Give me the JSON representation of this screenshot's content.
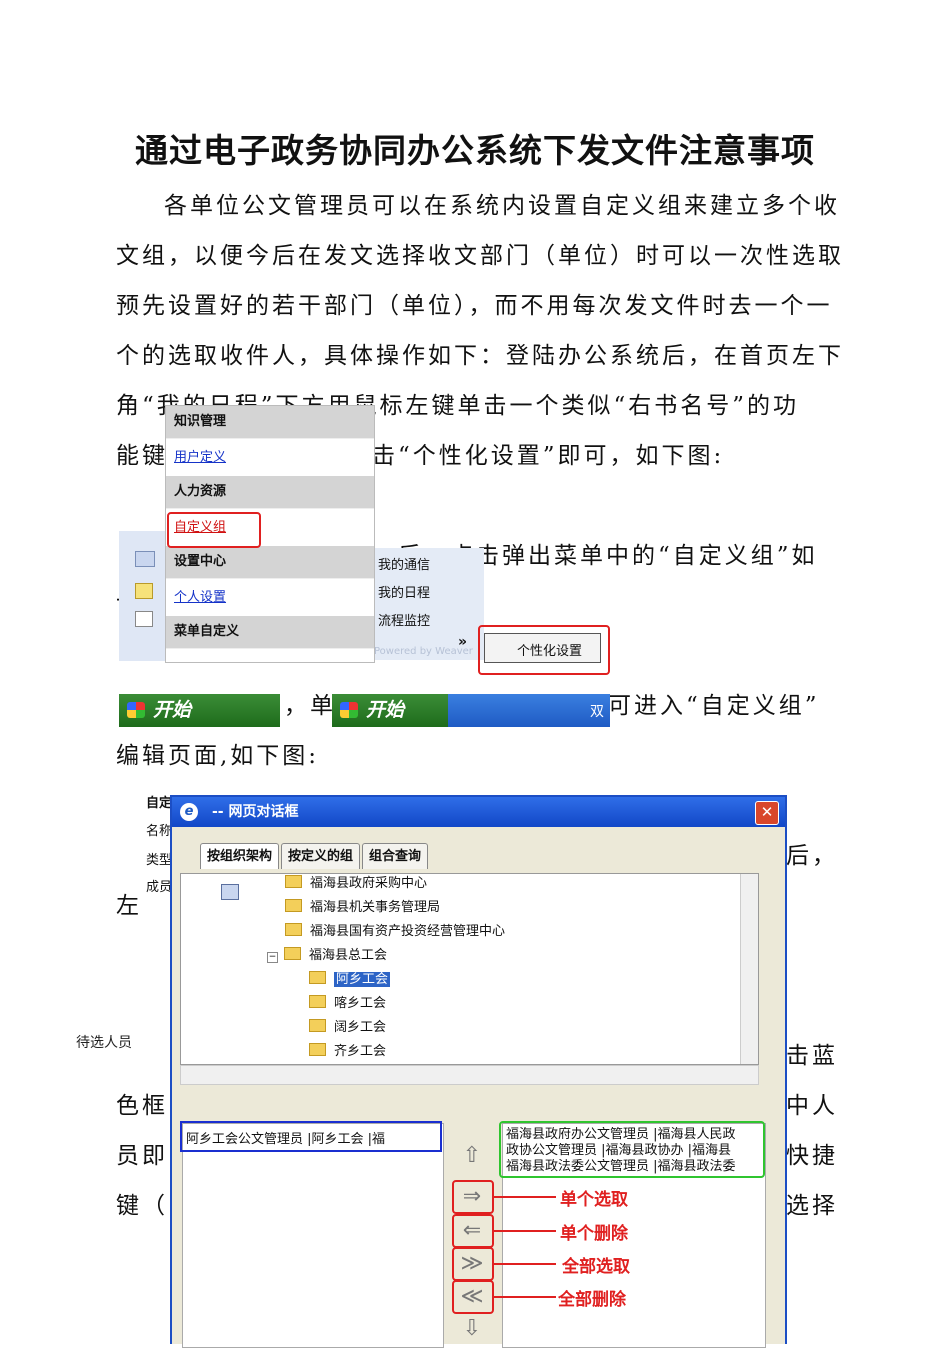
{
  "title": "通过电子政务协同办公系统下发文件注意事项",
  "body_lines": [
    "各单位公文管理员可以在系统内设置自定义组来建立多个收",
    "文组，以便今后在发文选择收文部门（单位）时可以一次性选取",
    "预先设置好的若干部门（单位），而不用每次发文件时去一个一",
    "个的选取收件人，具体操作如下：登陆办公系统后，在首页左下",
    "角“我的日程”下方用鼠标左键单击一个类似“右书名号”的功",
    "能键",
    "击“个性化设置”即可，如下图:"
  ],
  "partial_texts": {
    "after_menu": "，后，点击弹出菜单中的“自定义组”如",
    "dash_left": "-",
    "after_bar_hou": "后，单",
    "after_bar_right": "可进入“自定义组”",
    "edit_page": "编辑页面,如下图:",
    "right_hou": "后，",
    "left_zuo": "左",
    "click_blue": "击蓝",
    "color_box": "色框",
    "person": "中人",
    "member": "员即",
    "shortcut": "快捷",
    "key": "键（",
    "select": "选择"
  },
  "menu": {
    "items": [
      {
        "type": "head",
        "label": "知识管理"
      },
      {
        "type": "link",
        "label": "用户定义"
      },
      {
        "type": "head",
        "label": "人力资源"
      },
      {
        "type": "link",
        "label": "自定义组"
      },
      {
        "type": "head",
        "label": "设置中心"
      },
      {
        "type": "link",
        "label": "个人设置"
      },
      {
        "type": "head",
        "label": "菜单自定义"
      }
    ]
  },
  "side_menu": {
    "items": [
      "我的通信",
      "我的日程",
      "流程监控"
    ],
    "chevron": "»",
    "popup": "个性化设置",
    "powered": "Powered by Weaver"
  },
  "taskbar": {
    "start": "开始",
    "tray_text": "双"
  },
  "dialog": {
    "title": "-- 网页对话框",
    "close": "✕",
    "tabs": [
      "按组织架构",
      "按定义的组",
      "组合查询"
    ],
    "tree_nodes": [
      {
        "label": "福海县政府采购中心",
        "indent": 0
      },
      {
        "label": "福海县机关事务管理局",
        "indent": 0
      },
      {
        "label": "福海县国有资产投资经营管理中心",
        "indent": 0
      },
      {
        "label": "福海县总工会",
        "indent": 0,
        "expanded": true
      },
      {
        "label": "阿乡工会",
        "indent": 1,
        "selected": true
      },
      {
        "label": "喀乡工会",
        "indent": 1
      },
      {
        "label": "阔乡工会",
        "indent": 1
      },
      {
        "label": "齐乡工会",
        "indent": 1
      }
    ],
    "left_list": "阿乡工会公文管理员 |阿乡工会        |福",
    "right_list": [
      "福海县政府办公文管理员 |福海县人民政",
      "政协公文管理员 |福海县政协办 |福海县",
      "福海县政法委公文管理员 |福海县政法委"
    ],
    "buttons": [
      {
        "glyph": "⇒",
        "label": "单个选取"
      },
      {
        "glyph": "⇐",
        "label": "单个删除"
      },
      {
        "glyph": "≫",
        "label": "全部选取"
      },
      {
        "glyph": "≪",
        "label": "全部删除"
      }
    ],
    "up": "⇧",
    "down": "⇩"
  },
  "background_form": {
    "labels": [
      "自定义组",
      "名称",
      "类型",
      "成员"
    ]
  },
  "side_label": "待选人员",
  "colors": {
    "accent_red": "#e02020",
    "xp_blue": "#1c4ec4",
    "start_green": "#2f8a2b",
    "link_blue": "#1533c8",
    "list_blue": "#1a2fd0",
    "list_green": "#2fc52f"
  }
}
